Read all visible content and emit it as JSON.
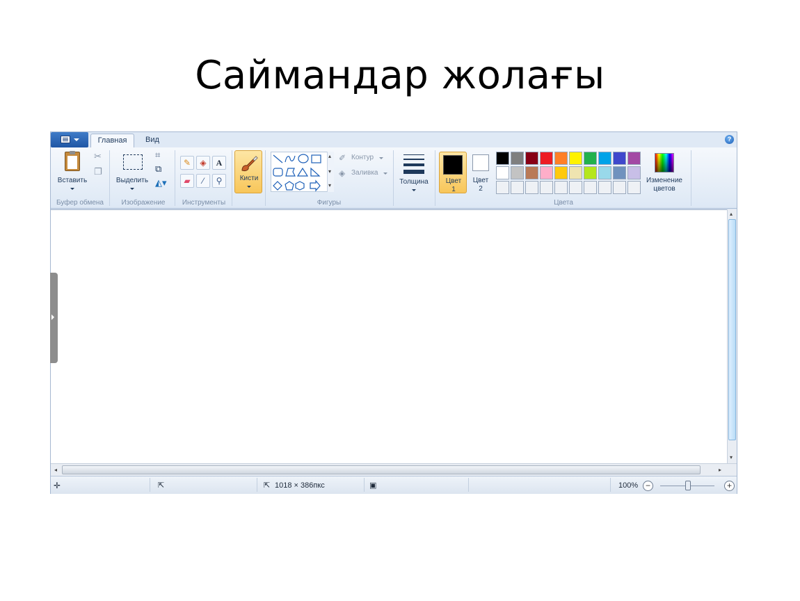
{
  "slide": {
    "title": "Саймандар жолағы"
  },
  "tabs": {
    "home": "Главная",
    "view": "Вид"
  },
  "ribbon": {
    "clipboard": {
      "paste_label": "Вставить",
      "group_label": "Буфер обмена"
    },
    "image": {
      "select_label": "Выделить",
      "group_label": "Изображение"
    },
    "tools": {
      "group_label": "Инструменты"
    },
    "brushes": {
      "label": "Кисти"
    },
    "shapes": {
      "outline_label": "Контур",
      "fill_label": "Заливка",
      "group_label": "Фигуры"
    },
    "size": {
      "label": "Толщина"
    },
    "colors": {
      "color1_label_line1": "Цвет",
      "color1_label_line2": "1",
      "color2_label_line1": "Цвет",
      "color2_label_line2": "2",
      "edit_label_line1": "Изменение",
      "edit_label_line2": "цветов",
      "group_label": "Цвета",
      "palette_row1": [
        "#000000",
        "#7f7f7f",
        "#880015",
        "#ed1c24",
        "#ff7f27",
        "#fff200",
        "#22b14c",
        "#00a2e8",
        "#3f48cc",
        "#a349a4"
      ],
      "palette_row2": [
        "#ffffff",
        "#c3c3c3",
        "#b97a57",
        "#ffaec9",
        "#ffc90e",
        "#efe4b0",
        "#b5e61d",
        "#99d9ea",
        "#7092be",
        "#c8bfe7"
      ],
      "palette_row3": [
        "#eef1f5",
        "#eef1f5",
        "#eef1f5",
        "#eef1f5",
        "#eef1f5",
        "#eef1f5",
        "#eef1f5",
        "#eef1f5",
        "#eef1f5",
        "#eef1f5"
      ]
    }
  },
  "status": {
    "canvas_size": "1018 × 386пкс",
    "zoom": "100%"
  },
  "icons": {
    "help": "help-icon",
    "move": "move-cross-icon",
    "selection_size": "selection-size-icon",
    "canvas_size": "canvas-size-icon",
    "disk": "disk-icon"
  }
}
